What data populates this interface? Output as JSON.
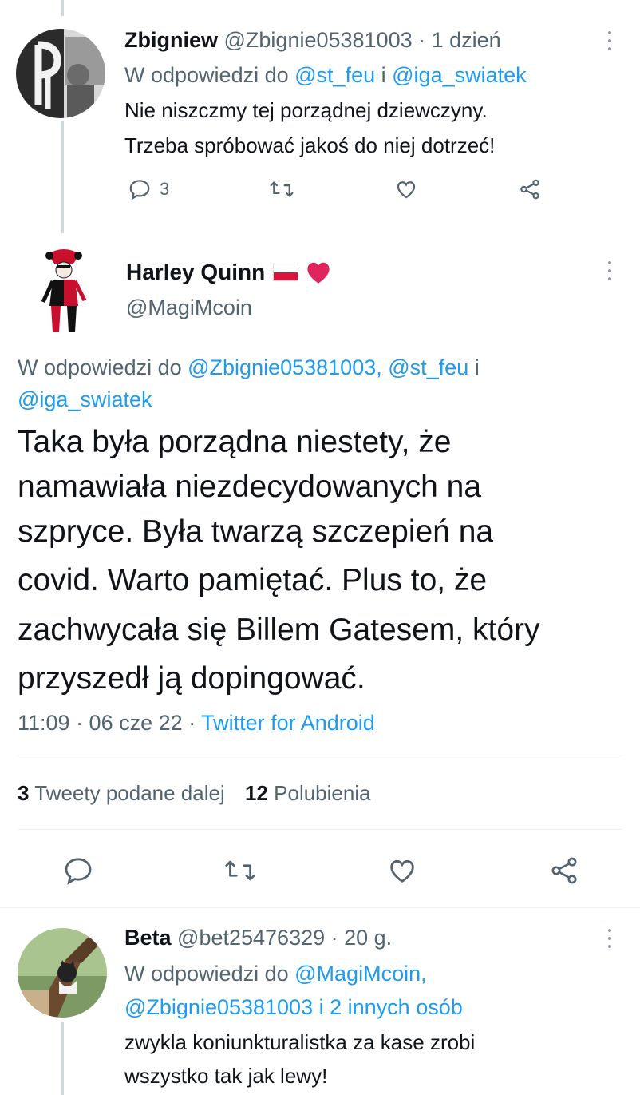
{
  "tweet1": {
    "name": "Zbigniew",
    "handle": "@Zbignie05381003",
    "time": "· 1 dzień",
    "reply_prefix": "W odpowiedzi do",
    "reply_to_1": "@st_feu",
    "reply_conj": "i",
    "reply_to_2": "@iga_swiatek",
    "text_lines": [
      "Nie niszczmy tej porządnej dziewczyny.",
      "Trzeba spróbować jakoś do niej dotrzeć!"
    ],
    "reply_count": "3",
    "icons": [
      "reply-icon",
      "retweet-icon",
      "like-icon",
      "share-icon"
    ]
  },
  "main_tweet": {
    "name": "Harley Quinn",
    "handle": "@MagiMcoin",
    "reply_prefix": "W odpowiedzi do",
    "reply_to_1": "@Zbignie05381003,",
    "reply_to_2": "@st_feu",
    "reply_conj": "i",
    "reply_to_3": "@iga_swiatek",
    "text_lines": [
      "Taka była porządna niestety, że",
      "namawiała niezdecydowanych na",
      "szpryce. Była twarzą szczepień na",
      "covid. Warto pamiętać. Plus to, że",
      "zachwycała się Billem Gatesem, który",
      "przyszedł ją dopingować."
    ],
    "timestamp": "11:09 · 06 cze 22 ·",
    "source": "Twitter for Android",
    "retweets_count": "3",
    "retweets_label": "Tweety podane dalej",
    "likes_count": "12",
    "likes_label": "Polubienia",
    "flag_colors": [
      "#ffffff",
      "#dc143c"
    ],
    "heart_color": "#e0245e"
  },
  "tweet3": {
    "name": "Beta",
    "handle": "@bet25476329",
    "time": "· 20 g.",
    "reply_prefix": "W odpowiedzi do",
    "reply_to_1": "@MagiMcoin,",
    "reply_to_2": "@Zbignie05381003",
    "reply_conj": "i",
    "reply_to_3": "2 innych osób",
    "text_lines": [
      "zwykla koniunkturalistka za kase zrobi",
      "wszystko tak jak lewy!"
    ]
  },
  "colors": {
    "accent": "#1d9bf0",
    "muted": "#536471",
    "text": "#0f1419"
  }
}
